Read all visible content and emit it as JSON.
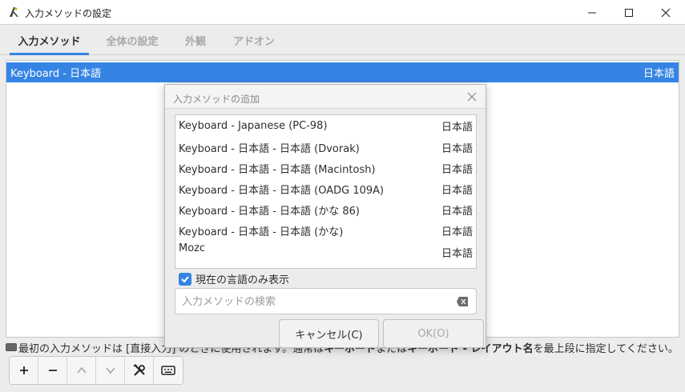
{
  "window": {
    "title": "入力メソッドの設定"
  },
  "tabs": [
    {
      "label": "入力メソッド",
      "active": true
    },
    {
      "label": "全体の設定",
      "active": false
    },
    {
      "label": "外観",
      "active": false
    },
    {
      "label": "アドオン",
      "active": false
    }
  ],
  "main_list": {
    "rows": [
      {
        "name": "Keyboard - 日本語",
        "lang": "日本語",
        "selected": true
      }
    ]
  },
  "info": {
    "prefix": "最初の入力メソッドは [直接入力",
    "middle": "] のときに使用されます。通常は ",
    "bold1": "キーボード",
    "mid2": " または ",
    "bold2": "キーボード - レイアウト名",
    "suffix": " を最上段に指定してください。"
  },
  "toolbar": {
    "buttons": [
      "add",
      "remove",
      "move-up",
      "move-down",
      "configure",
      "keyboard-layout"
    ]
  },
  "dialog": {
    "title": "入力メソッドの追加",
    "items": [
      {
        "name": "Keyboard - Japanese (PC-98)",
        "lang": "日本語"
      },
      {
        "name": "Keyboard - 日本語 - 日本語 (Dvorak)",
        "lang": "日本語"
      },
      {
        "name": "Keyboard - 日本語 - 日本語 (Macintosh)",
        "lang": "日本語"
      },
      {
        "name": "Keyboard - 日本語 - 日本語 (OADG 109A)",
        "lang": "日本語"
      },
      {
        "name": "Keyboard - 日本語 - 日本語 (かな 86)",
        "lang": "日本語"
      },
      {
        "name": "Keyboard - 日本語 - 日本語 (かな)",
        "lang": "日本語"
      },
      {
        "name": "Mozc",
        "lang": "日本語"
      }
    ],
    "checkbox_label": "現在の言語のみ表示",
    "checkbox_checked": true,
    "search_placeholder": "入力メソッドの検索",
    "cancel_label": "キャンセル(C)",
    "ok_label": "OK(O)"
  },
  "colors": {
    "accent": "#3584e4",
    "window_bg": "#ececec"
  }
}
